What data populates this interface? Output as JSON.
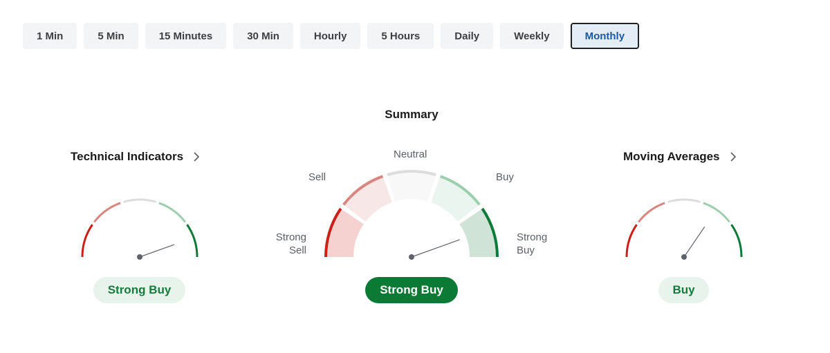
{
  "timeframes": {
    "items": [
      {
        "label": "1 Min"
      },
      {
        "label": "5 Min"
      },
      {
        "label": "15 Minutes"
      },
      {
        "label": "30 Min"
      },
      {
        "label": "Hourly"
      },
      {
        "label": "5 Hours"
      },
      {
        "label": "Daily"
      },
      {
        "label": "Weekly"
      },
      {
        "label": "Monthly"
      }
    ],
    "selected": "Monthly"
  },
  "summary": {
    "title": "Summary",
    "labels": {
      "neutral": "Neutral",
      "sell": "Sell",
      "buy": "Buy",
      "strong_sell_line1": "Strong",
      "strong_sell_line2": "Sell",
      "strong_buy_line1": "Strong",
      "strong_buy_line2": "Buy"
    },
    "result": "Strong Buy",
    "needle_level": 0.89
  },
  "technical_indicators": {
    "title": "Technical Indicators",
    "result": "Strong Buy",
    "needle_level": 0.89
  },
  "moving_averages": {
    "title": "Moving Averages",
    "result": "Buy",
    "needle_level": 0.69
  },
  "icons": {
    "title_link": "chevron-right-icon",
    "needle_pivot": "gauge-pivot-dot"
  },
  "colors": {
    "strong_sell": "#cc1f16",
    "sell": "#d98580",
    "neutral": "#dcdcdc",
    "buy": "#9ccfae",
    "strong_buy": "#0d7a37",
    "needle": "#5e636b",
    "selected_tab_text": "#1b5aa3",
    "result_pill_solid": "#0b7a35"
  }
}
